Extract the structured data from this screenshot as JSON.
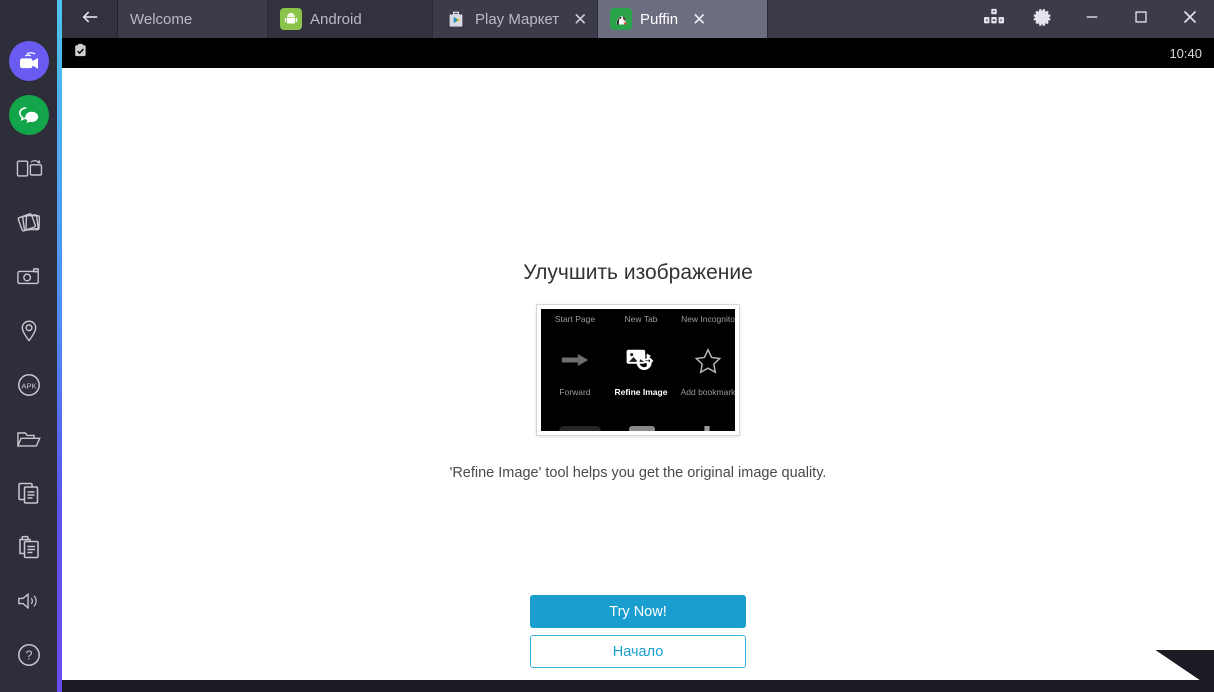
{
  "window": {
    "back_button": "back-arrow",
    "tabs": [
      {
        "label": "Welcome",
        "icon": "none",
        "closable": false,
        "active": false,
        "style": "plain"
      },
      {
        "label": "Android",
        "icon": "android-icon",
        "closable": false,
        "active": false,
        "style": "dark"
      },
      {
        "label": "Play Маркет",
        "icon": "play-store-icon",
        "closable": true,
        "active": false,
        "style": "plain"
      },
      {
        "label": "Puffin",
        "icon": "puffin-icon",
        "closable": true,
        "active": true,
        "style": "active"
      }
    ],
    "close_glyph": "✕",
    "controls": [
      {
        "name": "keymapping-button",
        "glyph": "keymap-icon"
      },
      {
        "name": "settings-button",
        "glyph": "gear-icon"
      },
      {
        "name": "minimize-button",
        "glyph": "minimize-icon"
      },
      {
        "name": "maximize-button",
        "glyph": "maximize-icon"
      },
      {
        "name": "close-button",
        "glyph": "close-icon"
      }
    ]
  },
  "sidebar": {
    "items": [
      {
        "name": "sidebar-item-record-stream",
        "icon": "video-stream-icon",
        "badge_color": "#6a5cf0"
      },
      {
        "name": "sidebar-item-messages",
        "icon": "chat-bubble-icon",
        "badge_color": "#13a54a"
      },
      {
        "name": "sidebar-item-rotate",
        "icon": "rotate-screen-icon",
        "badge_color": ""
      },
      {
        "name": "sidebar-item-shake",
        "icon": "shake-cards-icon",
        "badge_color": ""
      },
      {
        "name": "sidebar-item-screenshot",
        "icon": "camera-icon",
        "badge_color": ""
      },
      {
        "name": "sidebar-item-location",
        "icon": "location-pin-icon",
        "badge_color": ""
      },
      {
        "name": "sidebar-item-install-apk",
        "icon": "apk-icon",
        "badge_color": "",
        "label": "APK"
      },
      {
        "name": "sidebar-item-open-folder",
        "icon": "folder-icon",
        "badge_color": ""
      },
      {
        "name": "sidebar-item-copy",
        "icon": "copy-icon",
        "badge_color": ""
      },
      {
        "name": "sidebar-item-paste",
        "icon": "paste-icon",
        "badge_color": ""
      },
      {
        "name": "sidebar-item-volume",
        "icon": "volume-icon",
        "badge_color": ""
      },
      {
        "name": "sidebar-item-help",
        "icon": "help-icon",
        "badge_color": ""
      }
    ]
  },
  "status_bar": {
    "notification_icon": "clipboard-check-icon",
    "clock": "10:40"
  },
  "page": {
    "heading": "Улучшить изображение",
    "description": "'Refine Image' tool helps you get the original image quality.",
    "promo_image": {
      "alt": "refine-image-tutorial-screenshot",
      "labels_top": [
        "Start Page",
        "New Tab",
        "New Incognito"
      ],
      "labels_bottom": [
        "Forward",
        "Refine Image",
        "Add bookmark"
      ],
      "icons": [
        "forward-arrow-icon",
        "refine-image-icon",
        "star-outline-icon"
      ]
    },
    "primary_button": "Try Now!",
    "secondary_button": "Начало"
  },
  "colors": {
    "accent_blue": "#1a9ed0",
    "outline_blue": "#3bb3e0",
    "titlebar": "#3b3b4a",
    "tab_active": "#6d6d82",
    "sidebar_bg": "#2e2e3a"
  }
}
